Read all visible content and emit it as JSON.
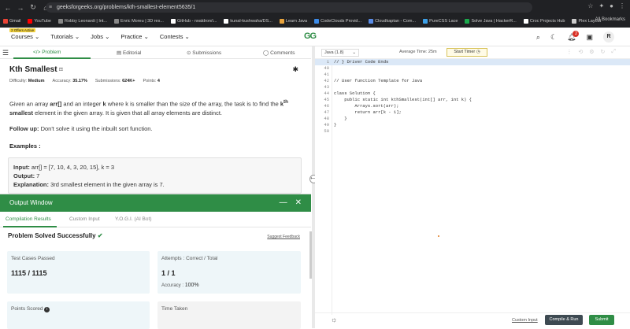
{
  "browser": {
    "url": "geeksforgeeks.org/problems/kth-smallest-element5635/1",
    "bookmarks": [
      {
        "label": "Gmail",
        "color": "#ea4335"
      },
      {
        "label": "YouTube",
        "color": "#ff0000"
      },
      {
        "label": "Robby Leonardi | Int...",
        "color": "#888888"
      },
      {
        "label": "Enric Moreu | 3D res...",
        "color": "#888888"
      },
      {
        "label": "GitHub - rwaldron/i...",
        "color": "#ffffff"
      },
      {
        "label": "kunal-kushwaha/DS...",
        "color": "#ffffff"
      },
      {
        "label": "Learn Java",
        "color": "#e8a33c"
      },
      {
        "label": "CodeClouds Provid...",
        "color": "#3c8be8"
      },
      {
        "label": "Cloudkaptan - Com...",
        "color": "#5a8de8"
      },
      {
        "label": "PureCSS Lace",
        "color": "#3ca0e8"
      },
      {
        "label": "Solve Java | HackerR...",
        "color": "#1ba94c"
      },
      {
        "label": "Croc Projects Hub",
        "color": "#ffffff"
      },
      {
        "label": "Plex Layout",
        "color": "#cccccc"
      }
    ],
    "all_bookmarks": "All Bookmarks"
  },
  "site": {
    "offers_badge": "2 Offers Active",
    "nav": [
      "Courses",
      "Tutorials",
      "Jobs",
      "Practice",
      "Contests"
    ],
    "logo_text": "GG",
    "notif_count": "2",
    "avatar_letter": "R"
  },
  "problem": {
    "tabs": [
      "Problem",
      "Editorial",
      "Submissions",
      "Comments"
    ],
    "title": "Kth Smallest",
    "meta": {
      "difficulty_label": "Difficulty:",
      "difficulty": "Medium",
      "accuracy_label": "Accuracy:",
      "accuracy": "35.17%",
      "submissions_label": "Submissions:",
      "submissions": "624K+",
      "points_label": "Points:",
      "points": "4"
    },
    "desc_p1": "Given an array",
    "desc_arr": "arr[]",
    "desc_p2": "and an integer",
    "desc_k": "k",
    "desc_p3": "where k is smaller than the size of the array, the task is to find the",
    "desc_kth": "k",
    "desc_th": "th",
    "desc_smallest": "smallest",
    "desc_p4": "element in the given array. It is given that all array elements are distinct.",
    "followup_label": "Follow up:",
    "followup_text": "Don't solve it using the inbuilt sort function.",
    "examples_label": "Examples :",
    "example": {
      "input_label": "Input:",
      "input": "arr[] = [7, 10, 4, 3, 20, 15], k = 3",
      "output_label": "Output:",
      "output": "7",
      "expl_label": "Explanation:",
      "expl": "3rd smallest element in the given array is 7."
    }
  },
  "output": {
    "title": "Output Window",
    "tabs": [
      "Compilation Results",
      "Custom Input",
      "Y.O.G.I. (AI Bot)"
    ],
    "status": "Problem Solved Successfully",
    "feedback": "Suggest Feedback",
    "cards": {
      "tests_label": "Test Cases Passed",
      "tests_value": "1115 / 1115",
      "attempts_label": "Attempts : Correct / Total",
      "attempts_value": "1 / 1",
      "accuracy_label": "Accuracy :",
      "accuracy_value": "100%",
      "points_label": "Points Scored",
      "time_label": "Time Taken"
    }
  },
  "editor": {
    "language": "Java (1.8)",
    "avg_time": "Average Time: 25m",
    "timer_label": "Start Timer",
    "lines": [
      {
        "n": "1",
        "t": "// } Driver Code Ends",
        "hl": true,
        "cls": "cm"
      },
      {
        "n": "40",
        "t": ""
      },
      {
        "n": "41",
        "t": ""
      },
      {
        "n": "42",
        "t": "// User function Template for Java",
        "cls": "cm"
      },
      {
        "n": "43",
        "t": ""
      },
      {
        "n": "44",
        "t": "class Solution {"
      },
      {
        "n": "45",
        "t": "    public static int kthSmallest(int[] arr, int k) {"
      },
      {
        "n": "46",
        "t": "        Arrays.sort(arr);"
      },
      {
        "n": "47",
        "t": "        return arr[k - 1];"
      },
      {
        "n": "48",
        "t": "    }"
      },
      {
        "n": "49",
        "t": "}"
      },
      {
        "n": "50",
        "t": ""
      }
    ],
    "custom_input": "Custom Input",
    "compile_label": "Compile & Run",
    "submit_label": "Submit"
  }
}
